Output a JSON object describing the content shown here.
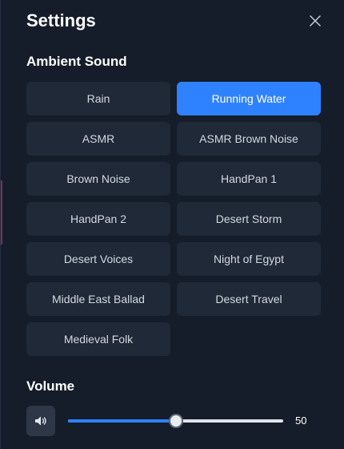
{
  "header": {
    "title": "Settings"
  },
  "ambient": {
    "title": "Ambient Sound",
    "options": [
      {
        "label": "Rain",
        "active": false
      },
      {
        "label": "Running Water",
        "active": true
      },
      {
        "label": "ASMR",
        "active": false
      },
      {
        "label": "ASMR Brown Noise",
        "active": false
      },
      {
        "label": "Brown Noise",
        "active": false
      },
      {
        "label": "HandPan 1",
        "active": false
      },
      {
        "label": "HandPan 2",
        "active": false
      },
      {
        "label": "Desert Storm",
        "active": false
      },
      {
        "label": "Desert Voices",
        "active": false
      },
      {
        "label": "Night of Egypt",
        "active": false
      },
      {
        "label": "Middle East Ballad",
        "active": false
      },
      {
        "label": "Desert Travel",
        "active": false
      },
      {
        "label": "Medieval Folk",
        "active": false
      }
    ]
  },
  "volume": {
    "title": "Volume",
    "value": 50,
    "value_label": "50",
    "min": 0,
    "max": 100,
    "icon": "speaker-icon"
  },
  "colors": {
    "background": "#151d2a",
    "option_bg": "#1f2937",
    "accent": "#2f82ff",
    "option_text": "#d4d9e1"
  }
}
